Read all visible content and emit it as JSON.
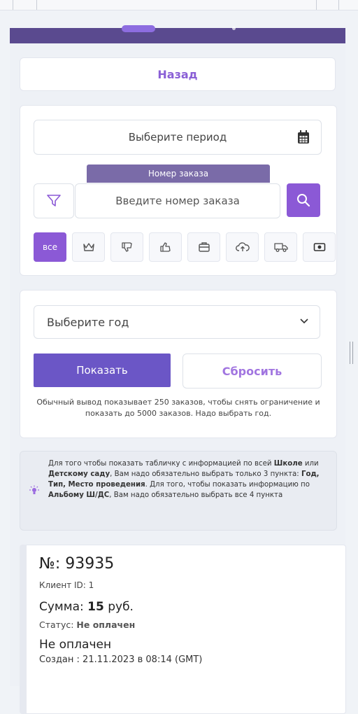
{
  "nav": {
    "back_label": "Назад"
  },
  "filters": {
    "period_placeholder": "Выберите период",
    "tooltip_label": "Номер заказа",
    "order_placeholder": "Введите номер заказа",
    "chips": [
      {
        "label": "все",
        "icon": "all",
        "active": true
      },
      {
        "label": "",
        "icon": "crown-icon"
      },
      {
        "label": "",
        "icon": "thumbs-down-icon"
      },
      {
        "label": "",
        "icon": "thumbs-up-icon"
      },
      {
        "label": "",
        "icon": "briefcase-icon"
      },
      {
        "label": "",
        "icon": "cloud-upload-icon"
      },
      {
        "label": "",
        "icon": "truck-icon"
      },
      {
        "label": "",
        "icon": "money-icon"
      }
    ]
  },
  "year": {
    "select_placeholder": "Выберите год",
    "show_label": "Показать",
    "reset_label": "Сбросить",
    "hint": "Обычный вывод показывает 250 заказов, чтобы снять ограничение и показать до 5000 заказов. Надо выбрать год."
  },
  "note": {
    "line1_pre": "Для того чтобы показать табличку с информацией по всей ",
    "school": "Школе",
    "or": " или ",
    "kindergarten": "Детскому саду",
    "line1_post": ", Вам надо обязательно выбрать только 3 пункта: ",
    "three_points": "Год, Тип, Место проведения",
    "line2_pre": ". Для того, чтобы показать информацию по ",
    "album": "Альбому Ш/ДС",
    "line2_post": ", Вам надо обязательно выбрать все 4 пункта"
  },
  "order": {
    "number": "№: 93935",
    "client": "Клиент ID: 1",
    "sum_prefix": "Сумма: ",
    "sum_value": "15",
    "sum_suffix": " руб.",
    "status_prefix": "Статус: ",
    "status_value": "Не оплачен",
    "unpaid": "Не оплачен",
    "created": "Создан : 21.11.2023 в 08:14 (GMT)"
  },
  "colors": {
    "accent": "#8b59d6",
    "header": "#5a4a8f",
    "primary_button": "#6b56c6"
  }
}
